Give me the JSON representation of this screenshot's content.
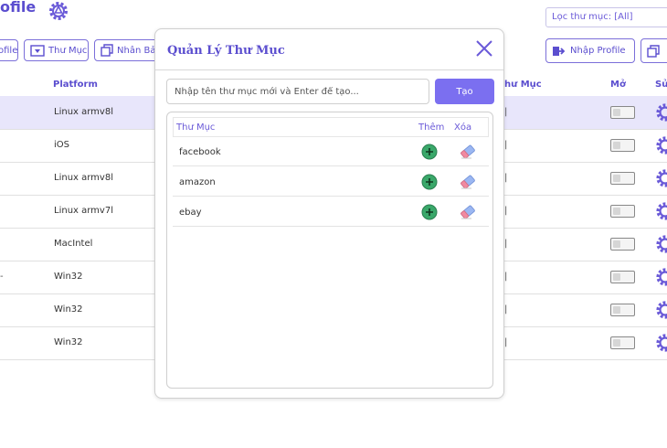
{
  "header": {
    "title": "ofile",
    "settings_icon": "gear-icon"
  },
  "filter": {
    "label": "Lọc thư mục: [All]"
  },
  "toolbar": {
    "profile_left": "ofile",
    "folder": "Thư Mục",
    "clone": "Nhân Bản",
    "import": "Nhập Profile"
  },
  "table": {
    "col_platform": "Platform",
    "col_folder": "hư Mục",
    "col_open": "Mở",
    "col_edit": "Sử",
    "rows": [
      {
        "platform": "Linux armv8l",
        "selected": true
      },
      {
        "platform": "iOS"
      },
      {
        "platform": "Linux armv8l"
      },
      {
        "platform": "Linux armv7l"
      },
      {
        "platform": "MacIntel"
      },
      {
        "platform": "Win32",
        "marker": "-"
      },
      {
        "platform": "Win32"
      },
      {
        "platform": "Win32"
      }
    ]
  },
  "modal": {
    "title": "Quản Lý Thư Mục",
    "input_placeholder": "Nhập tên thư mục mới và Enter để tạo...",
    "create_button": "Tạo",
    "col_folder": "Thư Mục",
    "col_add": "Thêm",
    "col_delete": "Xóa",
    "folders": [
      "facebook",
      "amazon",
      "ebay"
    ]
  },
  "colors": {
    "accent": "#5b4ecf",
    "button": "#7b6ff0",
    "selected_row": "#e8e6fb",
    "add_green": "#3aa86a"
  }
}
